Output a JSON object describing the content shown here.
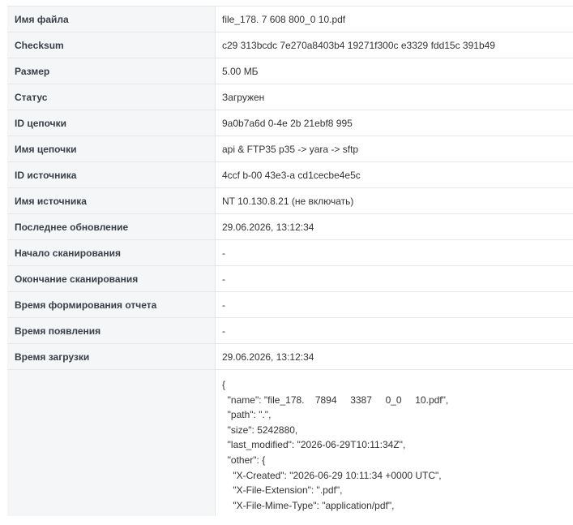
{
  "details": {
    "rows": [
      {
        "label": "Имя файла",
        "value": "file_178.  7    608     800_0   10.pdf"
      },
      {
        "label": "Checksum",
        "value": "c29   313bcdc     7e270a8403b4     19271f300c    e3329     fdd15c     391b49"
      },
      {
        "label": "Размер",
        "value": "5.00 МБ"
      },
      {
        "label": "Статус",
        "value": "Загружен"
      },
      {
        "label": "ID цепочки",
        "value": "9a0b7a6d     0-4e     2b   21ebf8    995"
      },
      {
        "label": "Имя цепочки",
        "value": "api & FTP35     p35 -> yara -> sftp"
      },
      {
        "label": "ID источника",
        "value": "4ccf     b-00     43e3-a     cd1cecbe4e5c"
      },
      {
        "label": "Имя источника",
        "value": "NT 10.130.8.21 (не включать)"
      },
      {
        "label": "Последнее обновление",
        "value": "29.06.2026, 13:12:34"
      },
      {
        "label": "Начало сканирования",
        "value": "-"
      },
      {
        "label": "Окончание сканирования",
        "value": "-"
      },
      {
        "label": "Время формирования отчета",
        "value": "-"
      },
      {
        "label": "Время появления",
        "value": "-"
      },
      {
        "label": "Время загрузки",
        "value": "29.06.2026, 13:12:34"
      }
    ],
    "metadata": {
      "label": "",
      "json_text": "{\n  \"name\": \"file_178.    7894     3387     0_0     10.pdf\",\n  \"path\": \".\",\n  \"size\": 5242880,\n  \"last_modified\": \"2026-06-29T10:11:34Z\",\n  \"other\": {\n    \"X-Created\": \"2026-06-29 10:11:34 +0000 UTC\",\n    \"X-File-Extension\": \".pdf\",\n    \"X-File-Mime-Type\": \"application/pdf\","
    }
  }
}
